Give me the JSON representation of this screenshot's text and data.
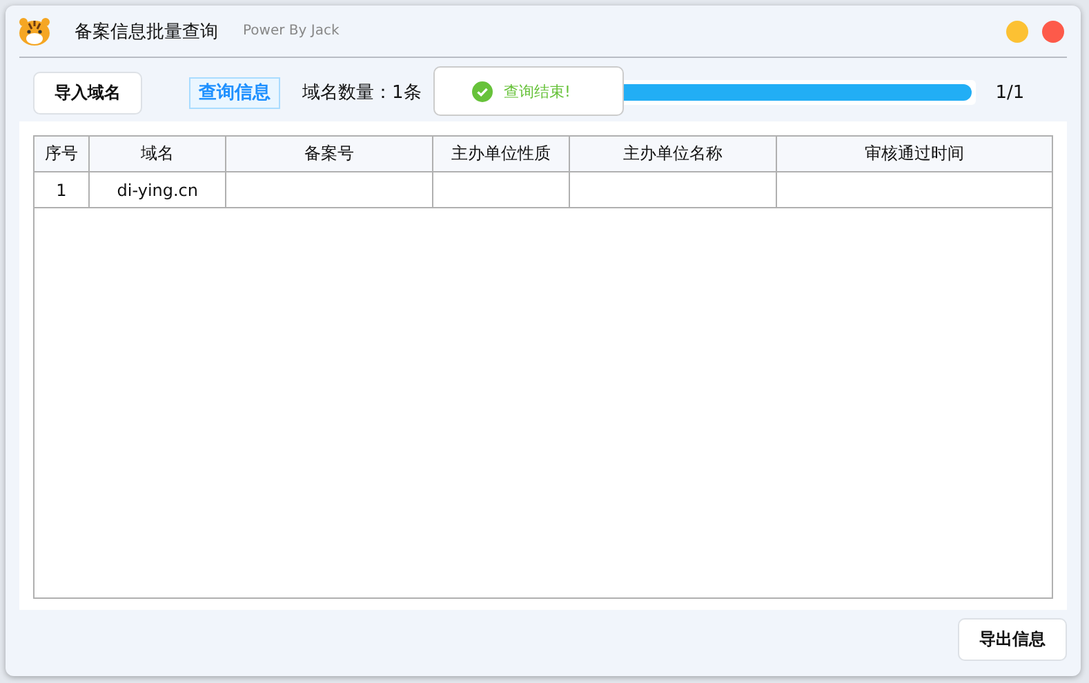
{
  "window": {
    "title": "备案信息批量查询",
    "subtitle": "Power By Jack"
  },
  "toolbar": {
    "import_button": "导入域名",
    "query_button": "查询信息",
    "count_label": "域名数量：1条",
    "progress": {
      "level": 1
    },
    "progress_text": "1/1"
  },
  "toast": {
    "message": "查询结束!"
  },
  "table": {
    "columns": [
      "序号",
      "域名",
      "备案号",
      "主办单位性质",
      "主办单位名称",
      "审核通过时间"
    ],
    "rows": [
      [
        "1",
        "di-ying.cn",
        "",
        "",
        "",
        ""
      ]
    ]
  },
  "export_button": "导出信息"
}
